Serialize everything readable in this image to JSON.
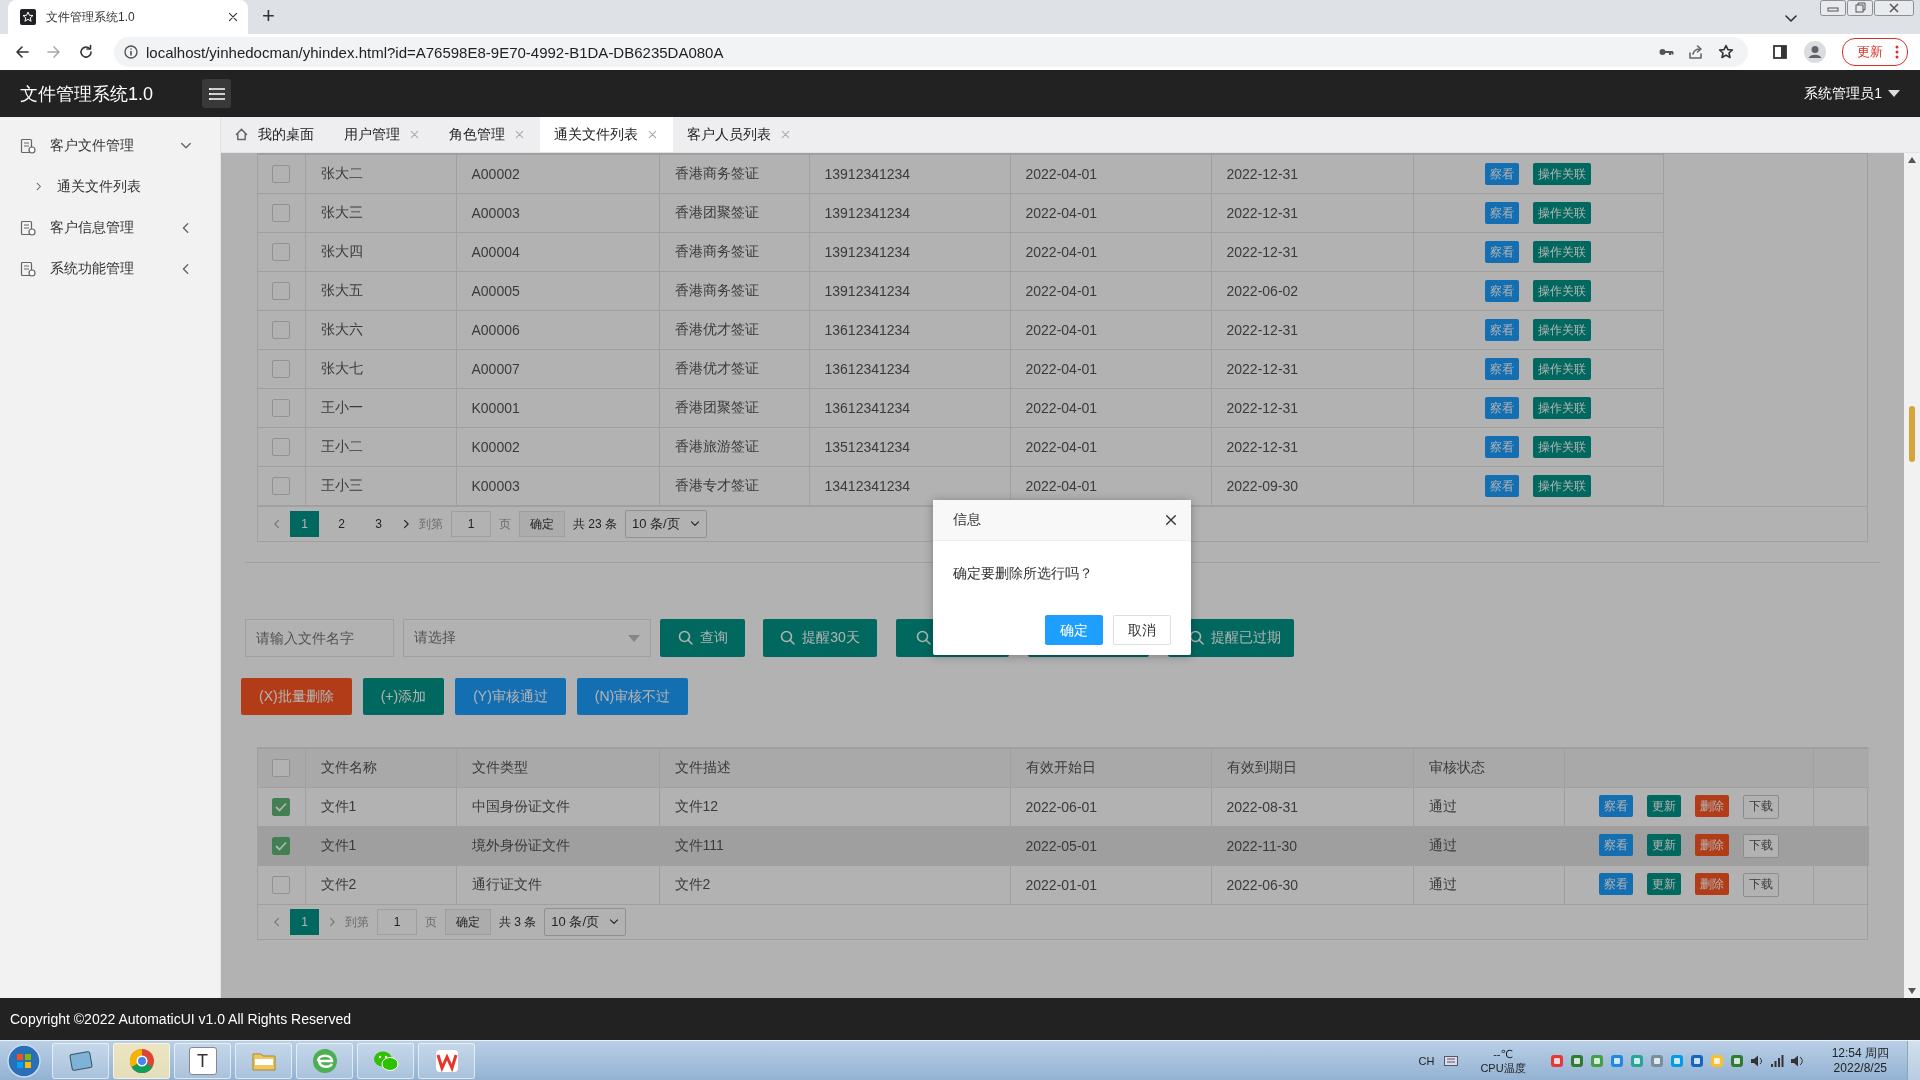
{
  "browser": {
    "tab_title": "文件管理系统1.0",
    "new_tab": "+",
    "url": "localhost/yinhedocman/yhindex.html?id=A76598E8-9E70-4992-B1DA-DB6235DA080A",
    "update_button": "更新"
  },
  "app": {
    "title": "文件管理系统1.0",
    "user": "系统管理员1"
  },
  "sidebar": {
    "items": [
      {
        "label": "客户文件管理",
        "expanded": true,
        "children": [
          {
            "label": "通关文件列表"
          }
        ]
      },
      {
        "label": "客户信息管理",
        "expanded": false
      },
      {
        "label": "系统功能管理",
        "expanded": false
      }
    ]
  },
  "tabs": [
    {
      "label": "我的桌面",
      "kind": "home",
      "selected": false
    },
    {
      "label": "用户管理",
      "kind": "page",
      "selected": false
    },
    {
      "label": "角色管理",
      "kind": "page",
      "selected": false
    },
    {
      "label": "通关文件列表",
      "kind": "page",
      "selected": true
    },
    {
      "label": "客户人员列表",
      "kind": "page",
      "selected": false
    }
  ],
  "client_table": {
    "rows": [
      {
        "checked": false,
        "cells": [
          "张大二",
          "A00002",
          "香港商务签证",
          "13912341234",
          "2022-04-01",
          "2022-12-31"
        ],
        "actions": [
          {
            "label": "察看",
            "kind": "info"
          },
          {
            "label": "操作关联",
            "kind": "primary"
          }
        ]
      },
      {
        "checked": false,
        "cells": [
          "张大三",
          "A00003",
          "香港团聚签证",
          "13912341234",
          "2022-04-01",
          "2022-12-31"
        ],
        "actions": [
          {
            "label": "察看",
            "kind": "info"
          },
          {
            "label": "操作关联",
            "kind": "primary"
          }
        ]
      },
      {
        "checked": false,
        "cells": [
          "张大四",
          "A00004",
          "香港商务签证",
          "13912341234",
          "2022-04-01",
          "2022-12-31"
        ],
        "actions": [
          {
            "label": "察看",
            "kind": "info"
          },
          {
            "label": "操作关联",
            "kind": "primary"
          }
        ]
      },
      {
        "checked": false,
        "cells": [
          "张大五",
          "A00005",
          "香港商务签证",
          "13912341234",
          "2022-04-01",
          "2022-06-02"
        ],
        "actions": [
          {
            "label": "察看",
            "kind": "info"
          },
          {
            "label": "操作关联",
            "kind": "primary"
          }
        ]
      },
      {
        "checked": false,
        "cells": [
          "张大六",
          "A00006",
          "香港优才签证",
          "13612341234",
          "2022-04-01",
          "2022-12-31"
        ],
        "actions": [
          {
            "label": "察看",
            "kind": "info"
          },
          {
            "label": "操作关联",
            "kind": "primary"
          }
        ]
      },
      {
        "checked": false,
        "cells": [
          "张大七",
          "A00007",
          "香港优才签证",
          "13612341234",
          "2022-04-01",
          "2022-12-31"
        ],
        "actions": [
          {
            "label": "察看",
            "kind": "info"
          },
          {
            "label": "操作关联",
            "kind": "primary"
          }
        ]
      },
      {
        "checked": false,
        "cells": [
          "王小一",
          "K00001",
          "香港团聚签证",
          "13612341234",
          "2022-04-01",
          "2022-12-31"
        ],
        "actions": [
          {
            "label": "察看",
            "kind": "info"
          },
          {
            "label": "操作关联",
            "kind": "primary"
          }
        ]
      },
      {
        "checked": false,
        "cells": [
          "王小二",
          "K00002",
          "香港旅游签证",
          "13512341234",
          "2022-04-01",
          "2022-12-31"
        ],
        "actions": [
          {
            "label": "察看",
            "kind": "info"
          },
          {
            "label": "操作关联",
            "kind": "primary"
          }
        ]
      },
      {
        "checked": false,
        "cells": [
          "王小三",
          "K00003",
          "香港专才签证",
          "13412341234",
          "2022-04-01",
          "2022-09-30"
        ],
        "actions": [
          {
            "label": "察看",
            "kind": "info"
          },
          {
            "label": "操作关联",
            "kind": "primary"
          }
        ]
      }
    ],
    "pagination": {
      "prev_disabled": true,
      "next_disabled": false,
      "pages": [
        {
          "label": "1",
          "selected": true
        },
        {
          "label": "2",
          "selected": false
        },
        {
          "label": "3",
          "selected": false
        }
      ],
      "goto_label": "到第",
      "page_input": "1",
      "page_unit": "页",
      "confirm": "确定",
      "total": "共 23 条",
      "page_size": "10 条/页"
    }
  },
  "search": {
    "placeholder": "请输入文件名字",
    "select_placeholder": "请选择",
    "buttons": [
      {
        "kind": "search",
        "label": "查询"
      },
      {
        "kind": "search",
        "label": "提醒30天"
      },
      {
        "kind": "search"
      },
      {
        "kind": "plain"
      },
      {
        "kind": "search",
        "label": "提醒已过期"
      }
    ]
  },
  "action_buttons": [
    {
      "label": "(X)批量删除",
      "kind": "danger"
    },
    {
      "label": "(+)添加",
      "kind": "primary"
    },
    {
      "label": "(Y)审核通过",
      "kind": "info"
    },
    {
      "label": "(N)审核不过",
      "kind": "info"
    }
  ],
  "file_table": {
    "header_checked": false,
    "columns": [
      "文件名称",
      "文件类型",
      "文件描述",
      "有效开始日",
      "有效到期日",
      "审核状态"
    ],
    "rows": [
      {
        "checked": true,
        "highlighted": false,
        "cells": [
          "文件1",
          "中国身份证文件",
          "文件12",
          "2022-06-01",
          "2022-08-31",
          "通过"
        ],
        "actions": [
          {
            "label": "察看",
            "kind": "info"
          },
          {
            "label": "更新",
            "kind": "primary"
          },
          {
            "label": "删除",
            "kind": "danger"
          },
          {
            "label": "下载",
            "kind": "plain"
          }
        ]
      },
      {
        "checked": true,
        "highlighted": true,
        "cells": [
          "文件1",
          "境外身份证文件",
          "文件111",
          "2022-05-01",
          "2022-11-30",
          "通过"
        ],
        "actions": [
          {
            "label": "察看",
            "kind": "info"
          },
          {
            "label": "更新",
            "kind": "primary"
          },
          {
            "label": "删除",
            "kind": "danger"
          },
          {
            "label": "下载",
            "kind": "plain"
          }
        ]
      },
      {
        "checked": false,
        "highlighted": false,
        "cells": [
          "文件2",
          "通行证文件",
          "文件2",
          "2022-01-01",
          "2022-06-30",
          "通过"
        ],
        "actions": [
          {
            "label": "察看",
            "kind": "info"
          },
          {
            "label": "更新",
            "kind": "primary"
          },
          {
            "label": "删除",
            "kind": "danger"
          },
          {
            "label": "下载",
            "kind": "plain"
          }
        ]
      }
    ],
    "pagination": {
      "prev_disabled": true,
      "next_disabled": true,
      "pages": [
        {
          "label": "1",
          "selected": true
        }
      ],
      "goto_label": "到第",
      "page_input": "1",
      "page_unit": "页",
      "confirm": "确定",
      "total": "共 3 条",
      "page_size": "10 条/页"
    }
  },
  "dialog": {
    "title": "信息",
    "message": "确定要删除所选行吗？",
    "buttons": [
      {
        "label": "确定",
        "kind": "primary"
      },
      {
        "label": "取消",
        "kind": "plain"
      }
    ]
  },
  "footer": {
    "copyright": "Copyright ©2022 AutomaticUI v1.0 All Rights Reserved"
  },
  "taskbar": {
    "apps": [
      {
        "kind": "tablet",
        "selected": false
      },
      {
        "kind": "browser",
        "selected": true
      },
      {
        "kind": "text",
        "label": "T",
        "selected": false
      },
      {
        "kind": "folder",
        "selected": false
      },
      {
        "kind": "globe",
        "selected": false
      },
      {
        "kind": "chat",
        "selected": false
      },
      {
        "kind": "office",
        "selected": false
      }
    ],
    "ime": "CH",
    "temperature": "--℃",
    "temperature_label": "CPU温度",
    "time": "12:54 周四",
    "date": "2022/8/25"
  }
}
